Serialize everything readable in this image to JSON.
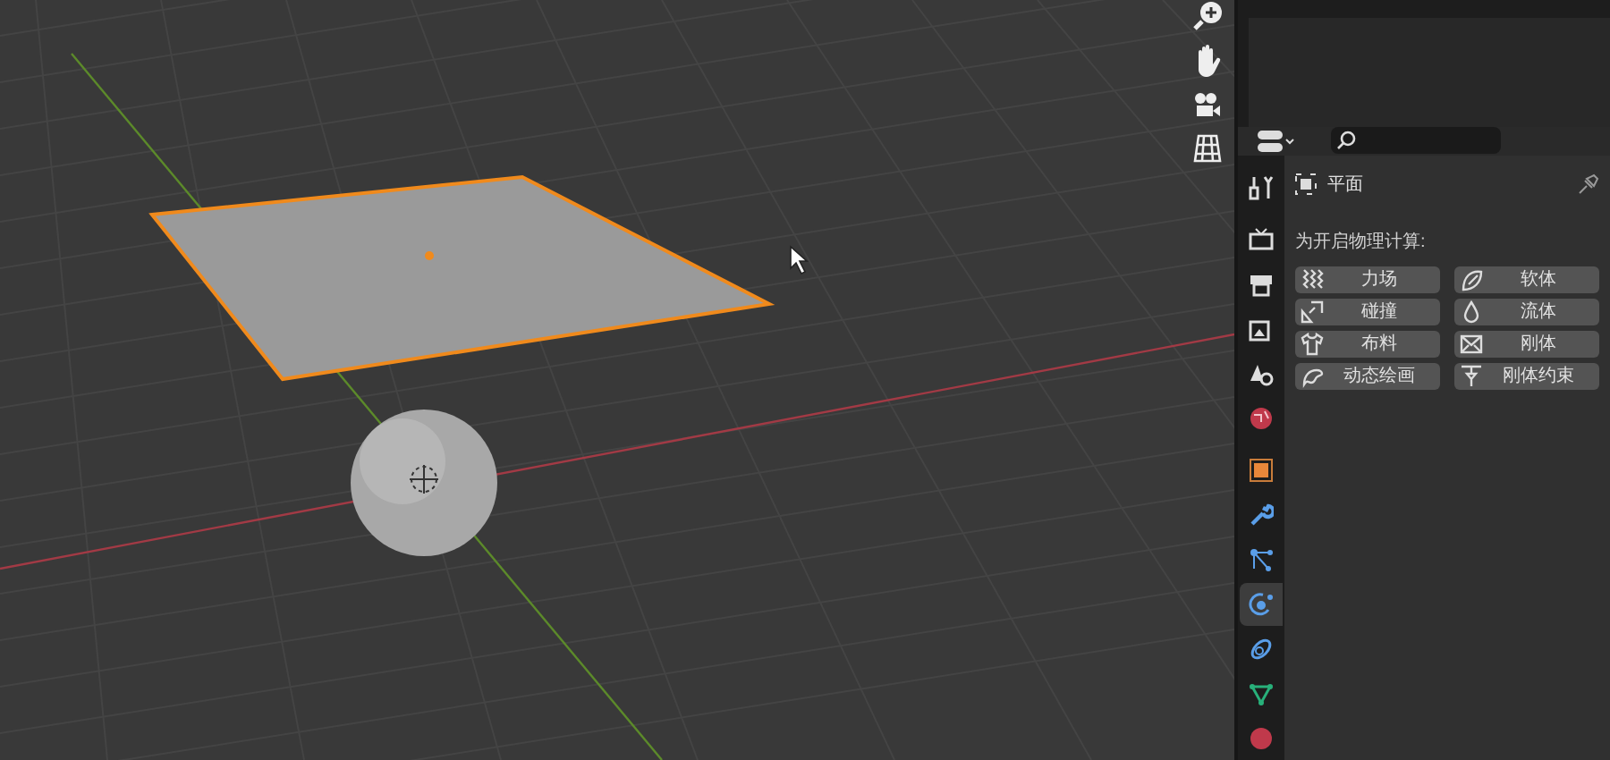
{
  "properties": {
    "object_name": "平面",
    "section_heading": "为开启物理计算:",
    "buttons": [
      {
        "label": "力场",
        "kind": "force"
      },
      {
        "label": "软体",
        "kind": "soft"
      },
      {
        "label": "碰撞",
        "kind": "collision"
      },
      {
        "label": "流体",
        "kind": "fluid"
      },
      {
        "label": "布料",
        "kind": "cloth"
      },
      {
        "label": "刚体",
        "kind": "rigid"
      },
      {
        "label": "动态绘画",
        "kind": "paint"
      },
      {
        "label": "刚体约束",
        "kind": "constraint"
      }
    ],
    "tabs": [
      {
        "kind": "tool",
        "selected": false
      },
      {
        "kind": "render",
        "selected": false
      },
      {
        "kind": "output",
        "selected": false
      },
      {
        "kind": "view",
        "selected": false
      },
      {
        "kind": "scene",
        "selected": false
      },
      {
        "kind": "world",
        "selected": false
      },
      {
        "kind": "object",
        "selected": false
      },
      {
        "kind": "modifier",
        "selected": false
      },
      {
        "kind": "particles",
        "selected": false
      },
      {
        "kind": "physics",
        "selected": true
      },
      {
        "kind": "constraints",
        "selected": false
      },
      {
        "kind": "data",
        "selected": false
      },
      {
        "kind": "material",
        "selected": false
      }
    ]
  }
}
